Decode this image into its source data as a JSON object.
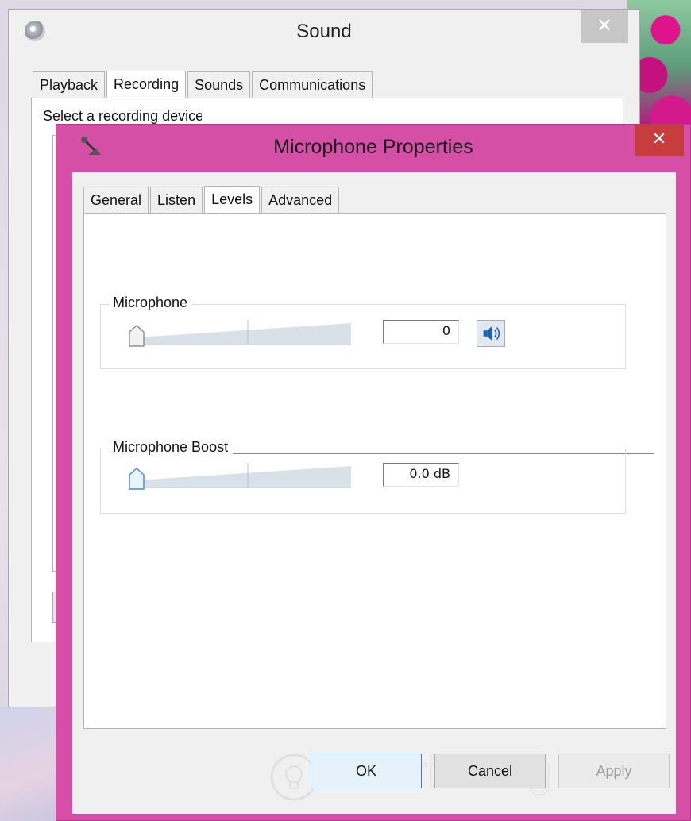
{
  "sound_window": {
    "title": "Sound",
    "close_label": "✕",
    "tabs": [
      {
        "label": "Playback",
        "active": false
      },
      {
        "label": "Recording",
        "active": true
      },
      {
        "label": "Sounds",
        "active": false
      },
      {
        "label": "Communications",
        "active": false
      }
    ],
    "description_partial": "Select a recording device below to modify its settings:"
  },
  "mic_window": {
    "title": "Microphone Properties",
    "close_label": "✕",
    "tabs": [
      {
        "label": "General",
        "active": false
      },
      {
        "label": "Listen",
        "active": false
      },
      {
        "label": "Levels",
        "active": true
      },
      {
        "label": "Advanced",
        "active": false
      }
    ],
    "microphone": {
      "label": "Microphone",
      "value": "0",
      "level_fraction": 0.0,
      "speaker_icon": "speaker-volume-icon"
    },
    "boost": {
      "label": "Microphone Boost",
      "value": "0.0 dB",
      "level_fraction": 0.0
    },
    "buttons": {
      "ok": "OK",
      "cancel": "Cancel",
      "apply": "Apply"
    },
    "watermark": {
      "text": "uantrimang",
      "icon": "lightbulb-logo-icon"
    }
  },
  "colors": {
    "accent_border": "#d44fa5",
    "close_red": "#c73c3c",
    "default_button_border": "#3c7fb1",
    "slider_track": "#d9e1e8",
    "thumb_selected": "#3c8ed6"
  }
}
